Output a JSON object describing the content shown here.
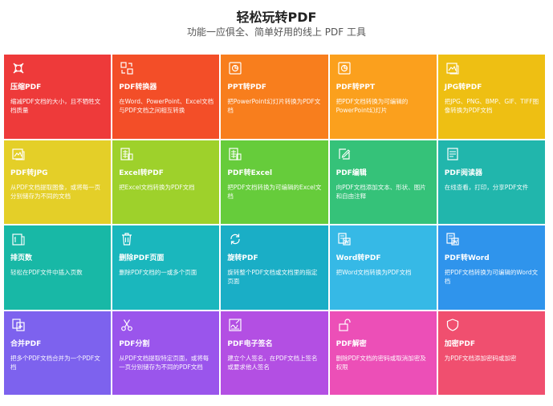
{
  "header": {
    "title": "轻松玩转PDF",
    "subtitle": "功能一应俱全、简单好用的线上 PDF 工具"
  },
  "tools": [
    {
      "key": "compress",
      "name": "压缩PDF",
      "desc": "缩减PDF文档的大小，且不牺牲文档质量",
      "color": "#ee3a3a",
      "icon": "compress-icon"
    },
    {
      "key": "pdf-converter",
      "name": "PDF转换器",
      "desc": "在Word、PowerPoint、Excel文档与PDF文档之间相互转换",
      "color": "#f34e28",
      "icon": "converter-icon"
    },
    {
      "key": "ppt-to-pdf",
      "name": "PPT转PDF",
      "desc": "把PowerPoint幻灯片转换为PDF文档",
      "color": "#f87e1d",
      "icon": "ppt-icon"
    },
    {
      "key": "pdf-to-ppt",
      "name": "PDF转PPT",
      "desc": "把PDF文档转换为可编辑的PowerPoint幻灯片",
      "color": "#fba01d",
      "icon": "ppt-icon"
    },
    {
      "key": "jpg-to-pdf",
      "name": "JPG转PDF",
      "desc": "把JPG、PNG、BMP、GIF、TIFF图像转换为PDF文档",
      "color": "#eebf13",
      "icon": "image-icon"
    },
    {
      "key": "pdf-to-jpg",
      "name": "PDF转JPG",
      "desc": "从PDF文档提取图像，或将每一页分别储存为不同的文档",
      "color": "#e4cf28",
      "icon": "image-icon"
    },
    {
      "key": "excel-to-pdf",
      "name": "Excel转PDF",
      "desc": "把Excel文档转换为PDF文档",
      "color": "#9ed12b",
      "icon": "excel-icon"
    },
    {
      "key": "pdf-to-excel",
      "name": "PDF转Excel",
      "desc": "把PDF文档转换为可编辑的Excel文档",
      "color": "#66cc3b",
      "icon": "excel-icon"
    },
    {
      "key": "pdf-edit",
      "name": "PDF编辑",
      "desc": "向PDF文档添加文本、形状、图片和自由注释",
      "color": "#35c279",
      "icon": "edit-icon"
    },
    {
      "key": "pdf-reader",
      "name": "PDF阅读器",
      "desc": "在线查看，打印，分享PDF文件",
      "color": "#21b6ac",
      "icon": "reader-icon"
    },
    {
      "key": "page-numbers",
      "name": "排页数",
      "desc": "轻松在PDF文件中插入页数",
      "color": "#18b8a6",
      "icon": "page-number-icon"
    },
    {
      "key": "delete-pages",
      "name": "删除PDF页面",
      "desc": "删除PDF文档的一或多个页面",
      "color": "#1ab7bd",
      "icon": "trash-icon"
    },
    {
      "key": "rotate-pdf",
      "name": "旋转PDF",
      "desc": "旋转整个PDF文档或文档里的指定页面",
      "color": "#1aaec6",
      "icon": "rotate-icon"
    },
    {
      "key": "word-to-pdf",
      "name": "Word转PDF",
      "desc": "把Word文档转换为PDF文档",
      "color": "#36b9e6",
      "icon": "word-icon"
    },
    {
      "key": "pdf-to-word",
      "name": "PDF转Word",
      "desc": "把PDF文档转换为可编辑的Word文档",
      "color": "#2f94ec",
      "icon": "word-icon"
    },
    {
      "key": "merge-pdf",
      "name": "合并PDF",
      "desc": "把多个PDF文档合并为一个PDF文档",
      "color": "#7d62ee",
      "icon": "merge-icon"
    },
    {
      "key": "split-pdf",
      "name": "PDF分割",
      "desc": "从PDF文档提取特定页面，或将每一页分别储存为不同的PDF文档",
      "color": "#9a55ec",
      "icon": "scissors-icon"
    },
    {
      "key": "esign-pdf",
      "name": "PDF电子签名",
      "desc": "建立个人签名，在PDF文档上签名或要求他人签名",
      "color": "#b34fe3",
      "icon": "signature-icon"
    },
    {
      "key": "unlock-pdf",
      "name": "PDF解密",
      "desc": "删除PDF文档的密码或取消加密及权限",
      "color": "#ec4fb7",
      "icon": "unlock-icon"
    },
    {
      "key": "protect-pdf",
      "name": "加密PDF",
      "desc": "为PDF文档添加密码或加密",
      "color": "#f04f6f",
      "icon": "shield-icon"
    }
  ]
}
